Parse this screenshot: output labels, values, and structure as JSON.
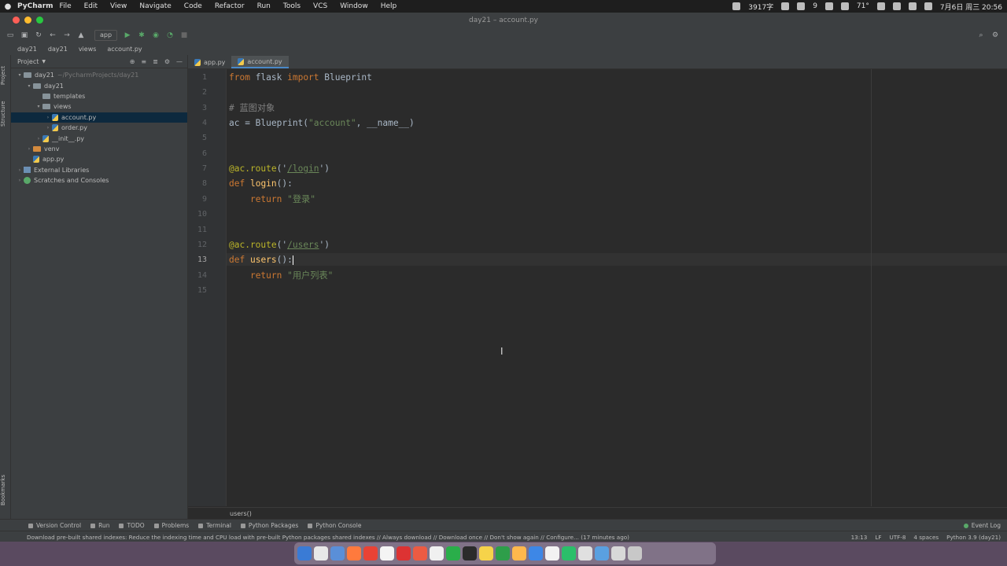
{
  "menubar": {
    "app_name": "PyCharm",
    "items": [
      "File",
      "Edit",
      "View",
      "Navigate",
      "Code",
      "Refactor",
      "Run",
      "Tools",
      "VCS",
      "Window",
      "Help"
    ],
    "status": {
      "word_count": "3917字",
      "wechat_count": "9",
      "weather": "71°",
      "datetime": "7月6日 周三 20:56"
    }
  },
  "window": {
    "title": "day21 – account.py"
  },
  "toolbar": {
    "run_config": "app"
  },
  "navbar": {
    "crumbs": [
      "day21",
      "day21",
      "views",
      "account.py"
    ]
  },
  "leftstrip": {
    "project_label": "Project",
    "structure_label": "Structure",
    "bookmarks_label": "Bookmarks"
  },
  "project_panel": {
    "title": "Project",
    "tree": [
      {
        "label": "day21",
        "hint": "~/PycharmProjects/day21",
        "indent": 0,
        "type": "folder",
        "arrow": "▾"
      },
      {
        "label": "day21",
        "hint": "",
        "indent": 1,
        "type": "folder",
        "arrow": "▾"
      },
      {
        "label": "templates",
        "hint": "",
        "indent": 2,
        "type": "folder",
        "arrow": ""
      },
      {
        "label": "views",
        "hint": "",
        "indent": 2,
        "type": "folder",
        "arrow": "▾"
      },
      {
        "label": "account.py",
        "hint": "",
        "indent": 3,
        "type": "py",
        "arrow": "›",
        "selected": true
      },
      {
        "label": "order.py",
        "hint": "",
        "indent": 3,
        "type": "py",
        "arrow": "›"
      },
      {
        "label": "__init__.py",
        "hint": "",
        "indent": 2,
        "type": "py",
        "arrow": "›"
      },
      {
        "label": "venv",
        "hint": "",
        "indent": 1,
        "type": "venv",
        "arrow": "›"
      },
      {
        "label": "app.py",
        "hint": "",
        "indent": 1,
        "type": "py",
        "arrow": ""
      },
      {
        "label": "External Libraries",
        "hint": "",
        "indent": 0,
        "type": "lib",
        "arrow": "›"
      },
      {
        "label": "Scratches and Consoles",
        "hint": "",
        "indent": 0,
        "type": "scratch",
        "arrow": "›"
      }
    ]
  },
  "tabs": [
    {
      "label": "app.py",
      "active": false
    },
    {
      "label": "account.py",
      "active": true
    }
  ],
  "editor": {
    "current_line": 13,
    "lines": [
      "from flask import Blueprint",
      "",
      "# 蓝图对象",
      "ac = Blueprint(\"account\", __name__)",
      "",
      "",
      "@ac.route('/login')",
      "def login():",
      "    return \"登录\"",
      "",
      "",
      "@ac.route('/users')",
      "def users():",
      "    return \"用户列表\"",
      ""
    ]
  },
  "code_breadcrumb": "users()",
  "bottom_tools": [
    "Version Control",
    "Run",
    "TODO",
    "Problems",
    "Terminal",
    "Python Packages",
    "Python Console"
  ],
  "event_log": "Event Log",
  "statusbar": {
    "message": "Download pre-built shared indexes: Reduce the indexing time and CPU load with pre-built Python packages shared indexes // Always download // Download once // Don't show again // Configure... (17 minutes ago)",
    "position": "13:13",
    "line_sep": "LF",
    "encoding": "UTF-8",
    "indent": "4 spaces",
    "interpreter": "Python 3.9 (day21)"
  },
  "colors": {
    "keyword": "#cc7832",
    "string": "#6a8759",
    "comment": "#808080",
    "decorator": "#bbb529",
    "function": "#ffc66d",
    "selection": "#0d293e"
  }
}
